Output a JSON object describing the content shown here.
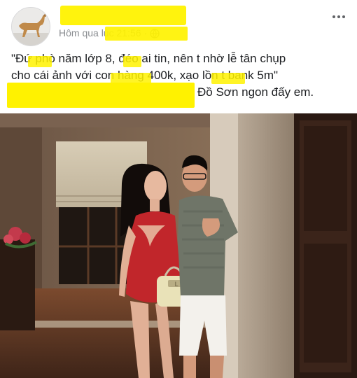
{
  "post": {
    "author": "",
    "timestamp": "Hôm qua lúc 21:56",
    "privacy_icon": "globe-icon",
    "more_icon": "more-options-icon",
    "text_lines": [
      "\"Đứ phò năm lớp 8, đéo ai tin, nên t nhờ lễ tân chụp",
      "cho cái ảnh với con hàng 400k, xạo lồn t bank 5m\"",
      "Đồ Sơn ngon đấy em."
    ]
  },
  "photo": {
    "bag_charm": "L",
    "colors": {
      "highlight": "#fff200",
      "dress": "#c1262b"
    }
  }
}
